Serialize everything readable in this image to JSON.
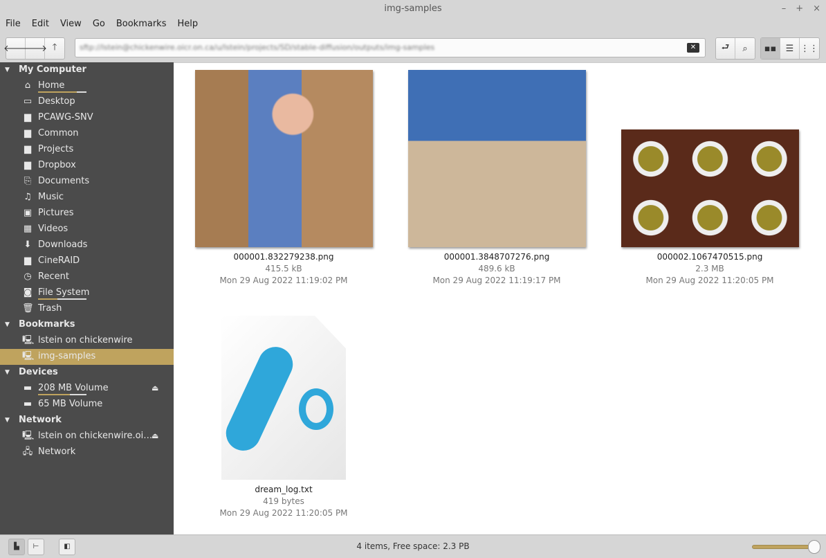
{
  "window": {
    "title": "img-samples",
    "controls": [
      "–",
      "+",
      "×"
    ]
  },
  "menu": [
    "File",
    "Edit",
    "View",
    "Go",
    "Bookmarks",
    "Help"
  ],
  "toolbar": {
    "back": "🡐",
    "forward": "🡒",
    "up": "🡑",
    "address": "sftp://lstein@chickenwire.oicr.on.ca/u/lstein/projects/SD/stable-diffusion/outputs/img-samples",
    "clear": "✕",
    "toggle_location": "⮐",
    "search": "⌕",
    "view_icons": "▪▪",
    "view_list": "☰",
    "view_compact": "⋮⋮"
  },
  "sidebar": {
    "sections": [
      {
        "title": "My Computer",
        "items": [
          {
            "label": "Home",
            "icon": "home-icon",
            "glyph": "⌂",
            "usage": 0.8
          },
          {
            "label": "Desktop",
            "icon": "desktop-icon",
            "glyph": "▭"
          },
          {
            "label": "PCAWG-SNV",
            "icon": "folder-icon",
            "glyph": "▆"
          },
          {
            "label": "Common",
            "icon": "folder-icon",
            "glyph": "▆"
          },
          {
            "label": "Projects",
            "icon": "folder-icon",
            "glyph": "▆"
          },
          {
            "label": "Dropbox",
            "icon": "folder-icon",
            "glyph": "▆"
          },
          {
            "label": "Documents",
            "icon": "documents-icon",
            "glyph": "⎘"
          },
          {
            "label": "Music",
            "icon": "music-icon",
            "glyph": "♫"
          },
          {
            "label": "Pictures",
            "icon": "pictures-icon",
            "glyph": "▣"
          },
          {
            "label": "Videos",
            "icon": "videos-icon",
            "glyph": "▦"
          },
          {
            "label": "Downloads",
            "icon": "downloads-icon",
            "glyph": "⬇"
          },
          {
            "label": "CineRAID",
            "icon": "folder-icon",
            "glyph": "▆"
          },
          {
            "label": "Recent",
            "icon": "clock-icon",
            "glyph": "◷"
          },
          {
            "label": "File System",
            "icon": "drive-icon",
            "glyph": "◙",
            "usage": 0.4
          },
          {
            "label": "Trash",
            "icon": "trash-icon",
            "glyph": "🗑"
          }
        ]
      },
      {
        "title": "Bookmarks",
        "items": [
          {
            "label": "lstein on chickenwire",
            "icon": "network-folder-icon",
            "glyph": "🖳"
          },
          {
            "label": "img-samples",
            "icon": "network-folder-icon",
            "glyph": "🖳",
            "selected": true
          }
        ]
      },
      {
        "title": "Devices",
        "items": [
          {
            "label": "208 MB Volume",
            "icon": "drive-icon",
            "glyph": "▬",
            "usage": 0.65,
            "eject": "⏏"
          },
          {
            "label": "65 MB Volume",
            "icon": "drive-icon",
            "glyph": "▬"
          }
        ]
      },
      {
        "title": "Network",
        "items": [
          {
            "label": "lstein on chickenwire.oi…",
            "icon": "network-folder-icon",
            "glyph": "🖳",
            "eject": "⏏"
          },
          {
            "label": "Network",
            "icon": "network-icon",
            "glyph": "🖧"
          }
        ]
      }
    ]
  },
  "files": [
    {
      "name": "000001.832279238.png",
      "size": "415.5 kB",
      "date": "Mon 29 Aug 2022 11:19:02 PM"
    },
    {
      "name": "000001.3848707276.png",
      "size": "489.6 kB",
      "date": "Mon 29 Aug 2022 11:19:17 PM"
    },
    {
      "name": "000002.1067470515.png",
      "size": "2.3 MB",
      "date": "Mon 29 Aug 2022 11:20:05 PM"
    },
    {
      "name": "dream_log.txt",
      "size": "419 bytes",
      "date": "Mon 29 Aug 2022 11:20:05 PM"
    }
  ],
  "status": {
    "text": "4 items, Free space: 2.3 PB",
    "zoom": 1.0
  },
  "colors": {
    "accent": "#bfa35e",
    "sidebar": "#4b4b4b"
  }
}
